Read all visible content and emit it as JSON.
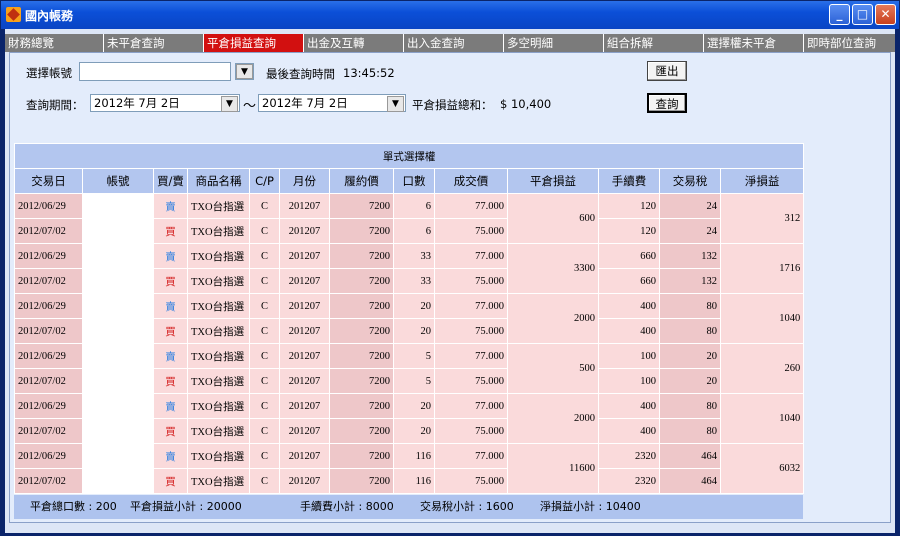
{
  "window": {
    "title": "國內帳務"
  },
  "titlebar": {
    "min": "_",
    "max": "□",
    "close": "✕"
  },
  "tabs": [
    "財務總覽",
    "未平倉查詢",
    "平倉損益查詢",
    "出金及互轉",
    "出入金查詢",
    "多空明細",
    "組合拆解",
    "選擇權未平倉",
    "即時部位查詢"
  ],
  "active_tab_index": 2,
  "form": {
    "account_label": "選擇帳號",
    "account_value": "",
    "last_query_label": "最後查詢時間",
    "last_query_time": "13:45:52",
    "export_button": "匯出",
    "period_label": "查詢期間：",
    "date_from": "2012年  7月  2日",
    "tilde": "～",
    "date_to": "2012年  7月  2日",
    "total_label": "平倉損益總和：",
    "total_value": "$ 10,400",
    "query_button": "查詢"
  },
  "table": {
    "caption": "單式選擇權",
    "columns": [
      "交易日",
      "帳號",
      "買/賣",
      "商品名稱",
      "C/P",
      "月份",
      "履約價",
      "口數",
      "成交價",
      "平倉損益",
      "手續費",
      "交易稅",
      "淨損益"
    ],
    "groups": [
      {
        "pnl": "600",
        "net": "312",
        "rows": [
          [
            "2012/06/29",
            "賣",
            "TXO台指選",
            "C",
            "201207",
            "7200",
            "6",
            "77.000",
            "120",
            "24"
          ],
          [
            "2012/07/02",
            "買",
            "TXO台指選",
            "C",
            "201207",
            "7200",
            "6",
            "75.000",
            "120",
            "24"
          ]
        ]
      },
      {
        "pnl": "3300",
        "net": "1716",
        "rows": [
          [
            "2012/06/29",
            "賣",
            "TXO台指選",
            "C",
            "201207",
            "7200",
            "33",
            "77.000",
            "660",
            "132"
          ],
          [
            "2012/07/02",
            "買",
            "TXO台指選",
            "C",
            "201207",
            "7200",
            "33",
            "75.000",
            "660",
            "132"
          ]
        ]
      },
      {
        "pnl": "2000",
        "net": "1040",
        "rows": [
          [
            "2012/06/29",
            "賣",
            "TXO台指選",
            "C",
            "201207",
            "7200",
            "20",
            "77.000",
            "400",
            "80"
          ],
          [
            "2012/07/02",
            "買",
            "TXO台指選",
            "C",
            "201207",
            "7200",
            "20",
            "75.000",
            "400",
            "80"
          ]
        ]
      },
      {
        "pnl": "500",
        "net": "260",
        "rows": [
          [
            "2012/06/29",
            "賣",
            "TXO台指選",
            "C",
            "201207",
            "7200",
            "5",
            "77.000",
            "100",
            "20"
          ],
          [
            "2012/07/02",
            "買",
            "TXO台指選",
            "C",
            "201207",
            "7200",
            "5",
            "75.000",
            "100",
            "20"
          ]
        ]
      },
      {
        "pnl": "2000",
        "net": "1040",
        "rows": [
          [
            "2012/06/29",
            "賣",
            "TXO台指選",
            "C",
            "201207",
            "7200",
            "20",
            "77.000",
            "400",
            "80"
          ],
          [
            "2012/07/02",
            "買",
            "TXO台指選",
            "C",
            "201207",
            "7200",
            "20",
            "75.000",
            "400",
            "80"
          ]
        ]
      },
      {
        "pnl": "11600",
        "net": "6032",
        "rows": [
          [
            "2012/06/29",
            "賣",
            "TXO台指選",
            "C",
            "201207",
            "7200",
            "116",
            "77.000",
            "2320",
            "464"
          ],
          [
            "2012/07/02",
            "買",
            "TXO台指選",
            "C",
            "201207",
            "7200",
            "116",
            "75.000",
            "2320",
            "464"
          ]
        ]
      }
    ]
  },
  "summary": {
    "lots": "平倉總口數 : 200",
    "pnl": "平倉損益小計 : 20000",
    "fee": "手續費小計 : 8000",
    "tax": "交易稅小計 : 1600",
    "net": "淨損益小計 : 10400"
  },
  "colors": {
    "title_blue": "#0b4fd8",
    "active_tab": "#d21010",
    "sell": "#2a7de1",
    "buy": "#d42020",
    "row_pink": "#fadadb",
    "header_blue": "#b3c6ef"
  }
}
